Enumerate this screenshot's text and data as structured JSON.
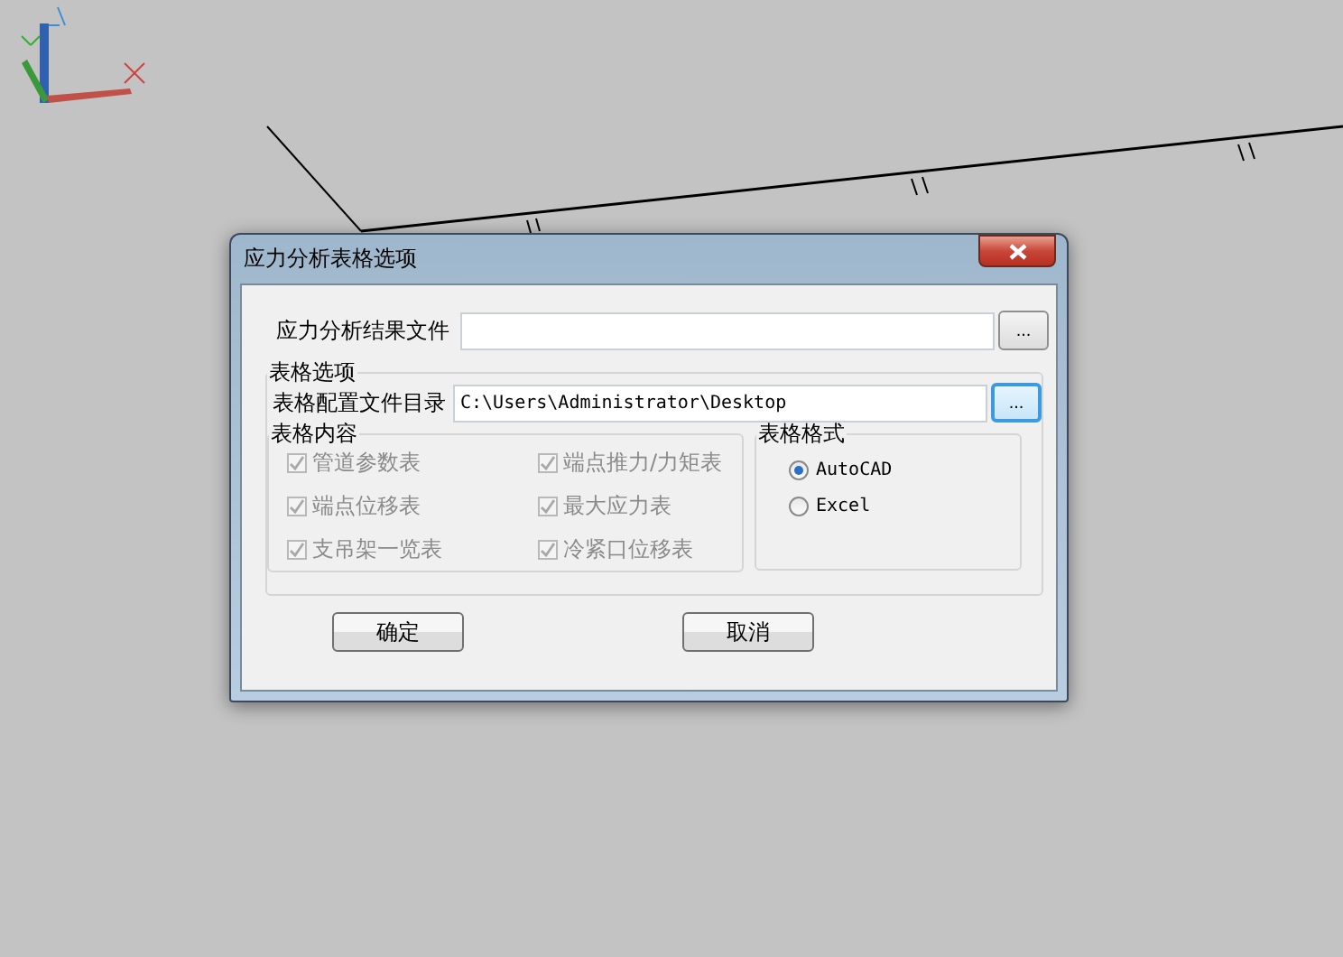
{
  "window": {
    "title": "应力分析表格选项"
  },
  "result_file": {
    "label": "应力分析结果文件",
    "browse": "..."
  },
  "options_group": {
    "title": "表格选项",
    "config_dir": {
      "label": "表格配置文件目录",
      "value": "C:\\Users\\Administrator\\Desktop",
      "browse": "...",
      "focused": true
    },
    "content_group": {
      "title": "表格内容",
      "items": [
        {
          "label": "管道参数表",
          "checked": true,
          "disabled": true
        },
        {
          "label": "端点推力/力矩表",
          "checked": true,
          "disabled": true
        },
        {
          "label": "端点位移表",
          "checked": true,
          "disabled": true
        },
        {
          "label": "最大应力表",
          "checked": true,
          "disabled": true
        },
        {
          "label": "支吊架一览表",
          "checked": true,
          "disabled": true
        },
        {
          "label": "冷紧口位移表",
          "checked": true,
          "disabled": true
        }
      ]
    },
    "format_group": {
      "title": "表格格式",
      "options": [
        {
          "label": "AutoCAD",
          "selected": true
        },
        {
          "label": "Excel",
          "selected": false
        }
      ]
    }
  },
  "buttons": [
    {
      "label": "确定"
    },
    {
      "label": "取消"
    }
  ]
}
